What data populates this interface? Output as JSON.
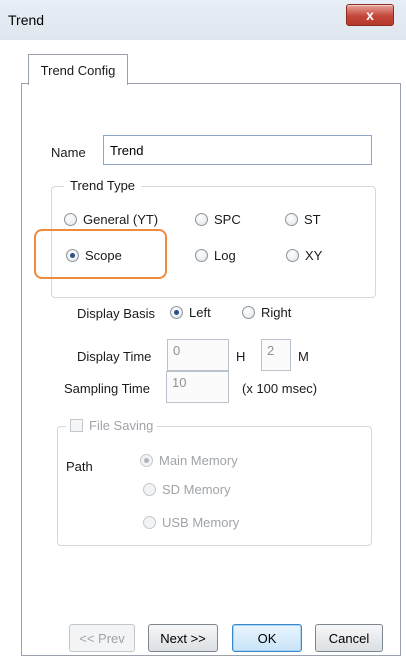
{
  "window": {
    "title": "Trend",
    "close_glyph": "x"
  },
  "tabs": [
    {
      "label": "Trend Config",
      "active": true
    }
  ],
  "name": {
    "label": "Name",
    "value": "Trend"
  },
  "trend_type": {
    "legend": "Trend Type",
    "options": [
      {
        "label": "General (YT)",
        "checked": false
      },
      {
        "label": "SPC",
        "checked": false
      },
      {
        "label": "ST",
        "checked": false
      },
      {
        "label": "Scope",
        "checked": true
      },
      {
        "label": "Log",
        "checked": false
      },
      {
        "label": "XY",
        "checked": false
      }
    ]
  },
  "display_basis": {
    "label": "Display Basis",
    "options": [
      {
        "label": "Left",
        "checked": true
      },
      {
        "label": "Right",
        "checked": false
      }
    ]
  },
  "display_time": {
    "label": "Display Time",
    "hours_value": "0",
    "hours_unit": "H",
    "minutes_value": "2",
    "minutes_unit": "M"
  },
  "sampling_time": {
    "label": "Sampling Time",
    "value": "10",
    "unit": "(x 100 msec)"
  },
  "file_saving": {
    "label": "File Saving",
    "checked": false,
    "path_label": "Path",
    "path_options": [
      {
        "label": "Main Memory",
        "checked": true
      },
      {
        "label": "SD Memory",
        "checked": false
      },
      {
        "label": "USB Memory",
        "checked": false
      }
    ]
  },
  "buttons": {
    "prev": "<< Prev",
    "next": "Next >>",
    "ok": "OK",
    "cancel": "Cancel"
  },
  "colors": {
    "highlight": "#f08a3c",
    "close_button": "#c3483a",
    "default_button": "#3a87c9"
  },
  "icons": {
    "close": "close-icon",
    "radio": "radio-button",
    "checkbox": "checkbox"
  }
}
